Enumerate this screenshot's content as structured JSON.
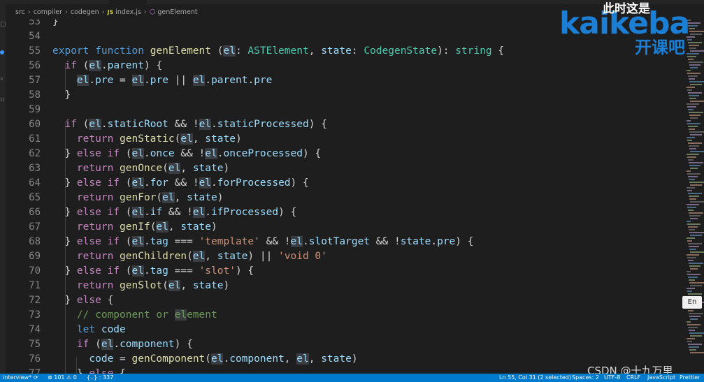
{
  "breadcrumb": [
    "src",
    "compiler",
    "codegen",
    "index.js",
    "genElement"
  ],
  "lines": [
    {
      "n": "53",
      "segs": [
        [
          "p",
          "}"
        ]
      ]
    },
    {
      "n": "54",
      "segs": []
    },
    {
      "n": "55",
      "segs": [
        [
          "kwb",
          "export "
        ],
        [
          "kwb",
          "function "
        ],
        [
          "fn",
          "genElement"
        ],
        [
          "p",
          " ("
        ],
        [
          "var hl",
          "el"
        ],
        [
          "p",
          ": "
        ],
        [
          "ty",
          "ASTElement"
        ],
        [
          "p",
          ", "
        ],
        [
          "var",
          "state"
        ],
        [
          "p",
          ": "
        ],
        [
          "ty",
          "CodegenState"
        ],
        [
          "p",
          "): "
        ],
        [
          "ty",
          "string"
        ],
        [
          "p",
          " {"
        ]
      ]
    },
    {
      "n": "56",
      "segs": [
        [
          "p",
          "  "
        ],
        [
          "kw",
          "if"
        ],
        [
          "p",
          " ("
        ],
        [
          "var hl",
          "el"
        ],
        [
          "p",
          "."
        ],
        [
          "var",
          "parent"
        ],
        [
          "p",
          ") {"
        ]
      ]
    },
    {
      "n": "57",
      "segs": [
        [
          "p",
          "    "
        ],
        [
          "var hl",
          "el"
        ],
        [
          "p",
          "."
        ],
        [
          "var",
          "pre"
        ],
        [
          "p",
          " = "
        ],
        [
          "var hl",
          "el"
        ],
        [
          "p",
          "."
        ],
        [
          "var",
          "pre"
        ],
        [
          "p",
          " || "
        ],
        [
          "var hl",
          "el"
        ],
        [
          "p",
          "."
        ],
        [
          "var",
          "parent"
        ],
        [
          "p",
          "."
        ],
        [
          "var",
          "pre"
        ]
      ]
    },
    {
      "n": "58",
      "segs": [
        [
          "p",
          "  }"
        ]
      ]
    },
    {
      "n": "59",
      "segs": []
    },
    {
      "n": "60",
      "segs": [
        [
          "p",
          "  "
        ],
        [
          "kw",
          "if"
        ],
        [
          "p",
          " ("
        ],
        [
          "var hl",
          "el"
        ],
        [
          "p",
          "."
        ],
        [
          "var",
          "staticRoot"
        ],
        [
          "p",
          " && !"
        ],
        [
          "var hl",
          "el"
        ],
        [
          "p",
          "."
        ],
        [
          "var",
          "staticProcessed"
        ],
        [
          "p",
          ") {"
        ]
      ]
    },
    {
      "n": "61",
      "segs": [
        [
          "p",
          "    "
        ],
        [
          "kw",
          "return "
        ],
        [
          "fn",
          "genStatic"
        ],
        [
          "p",
          "("
        ],
        [
          "var hl",
          "el"
        ],
        [
          "p",
          ", "
        ],
        [
          "var",
          "state"
        ],
        [
          "p",
          ")"
        ]
      ]
    },
    {
      "n": "62",
      "segs": [
        [
          "p",
          "  } "
        ],
        [
          "kw",
          "else if"
        ],
        [
          "p",
          " ("
        ],
        [
          "var hl",
          "el"
        ],
        [
          "p",
          "."
        ],
        [
          "var",
          "once"
        ],
        [
          "p",
          " && !"
        ],
        [
          "var hl",
          "el"
        ],
        [
          "p",
          "."
        ],
        [
          "var",
          "onceProcessed"
        ],
        [
          "p",
          ") {"
        ]
      ]
    },
    {
      "n": "63",
      "segs": [
        [
          "p",
          "    "
        ],
        [
          "kw",
          "return "
        ],
        [
          "fn",
          "genOnce"
        ],
        [
          "p",
          "("
        ],
        [
          "var hl",
          "el"
        ],
        [
          "p",
          ", "
        ],
        [
          "var",
          "state"
        ],
        [
          "p",
          ")"
        ]
      ]
    },
    {
      "n": "64",
      "segs": [
        [
          "p",
          "  } "
        ],
        [
          "kw",
          "else if"
        ],
        [
          "p",
          " ("
        ],
        [
          "var hl",
          "el"
        ],
        [
          "p",
          "."
        ],
        [
          "var",
          "for"
        ],
        [
          "p",
          " && !"
        ],
        [
          "var hl",
          "el"
        ],
        [
          "p",
          "."
        ],
        [
          "var",
          "forProcessed"
        ],
        [
          "p",
          ") {"
        ]
      ]
    },
    {
      "n": "65",
      "segs": [
        [
          "p",
          "    "
        ],
        [
          "kw",
          "return "
        ],
        [
          "fn",
          "genFor"
        ],
        [
          "p",
          "("
        ],
        [
          "var hl",
          "el"
        ],
        [
          "p",
          ", "
        ],
        [
          "var",
          "state"
        ],
        [
          "p",
          ")"
        ]
      ]
    },
    {
      "n": "66",
      "segs": [
        [
          "p",
          "  } "
        ],
        [
          "kw",
          "else if"
        ],
        [
          "p",
          " ("
        ],
        [
          "var hl",
          "el"
        ],
        [
          "p",
          "."
        ],
        [
          "var",
          "if"
        ],
        [
          "p",
          " && !"
        ],
        [
          "var hl",
          "el"
        ],
        [
          "p",
          "."
        ],
        [
          "var",
          "ifProcessed"
        ],
        [
          "p",
          ") {"
        ]
      ]
    },
    {
      "n": "67",
      "segs": [
        [
          "p",
          "    "
        ],
        [
          "kw",
          "return "
        ],
        [
          "fn",
          "genIf"
        ],
        [
          "p",
          "("
        ],
        [
          "var hl",
          "el"
        ],
        [
          "p",
          ", "
        ],
        [
          "var",
          "state"
        ],
        [
          "p",
          ")"
        ]
      ]
    },
    {
      "n": "68",
      "segs": [
        [
          "p",
          "  } "
        ],
        [
          "kw",
          "else if"
        ],
        [
          "p",
          " ("
        ],
        [
          "var hl",
          "el"
        ],
        [
          "p",
          "."
        ],
        [
          "var",
          "tag"
        ],
        [
          "p",
          " === "
        ],
        [
          "str",
          "'template'"
        ],
        [
          "p",
          " && !"
        ],
        [
          "var hl",
          "el"
        ],
        [
          "p",
          "."
        ],
        [
          "var",
          "slotTarget"
        ],
        [
          "p",
          " && !"
        ],
        [
          "var",
          "state"
        ],
        [
          "p",
          "."
        ],
        [
          "var",
          "pre"
        ],
        [
          "p",
          ") {"
        ]
      ]
    },
    {
      "n": "69",
      "segs": [
        [
          "p",
          "    "
        ],
        [
          "kw",
          "return "
        ],
        [
          "fn",
          "genChildren"
        ],
        [
          "p",
          "("
        ],
        [
          "var hl",
          "el"
        ],
        [
          "p",
          ", "
        ],
        [
          "var",
          "state"
        ],
        [
          "p",
          ") || "
        ],
        [
          "str",
          "'void 0'"
        ]
      ]
    },
    {
      "n": "70",
      "segs": [
        [
          "p",
          "  } "
        ],
        [
          "kw",
          "else if"
        ],
        [
          "p",
          " ("
        ],
        [
          "var hl",
          "el"
        ],
        [
          "p",
          "."
        ],
        [
          "var",
          "tag"
        ],
        [
          "p",
          " === "
        ],
        [
          "str",
          "'slot'"
        ],
        [
          "p",
          ") {"
        ]
      ]
    },
    {
      "n": "71",
      "segs": [
        [
          "p",
          "    "
        ],
        [
          "kw",
          "return "
        ],
        [
          "fn",
          "genSlot"
        ],
        [
          "p",
          "("
        ],
        [
          "var hl",
          "el"
        ],
        [
          "p",
          ", "
        ],
        [
          "var",
          "state"
        ],
        [
          "p",
          ")"
        ]
      ]
    },
    {
      "n": "72",
      "segs": [
        [
          "p",
          "  } "
        ],
        [
          "kw",
          "else"
        ],
        [
          "p",
          " {"
        ]
      ]
    },
    {
      "n": "73",
      "segs": [
        [
          "p",
          "    "
        ],
        [
          "cm",
          "// component or "
        ],
        [
          "cm hl",
          "el"
        ],
        [
          "cm",
          "ement"
        ]
      ]
    },
    {
      "n": "74",
      "segs": [
        [
          "p",
          "    "
        ],
        [
          "kwb",
          "let "
        ],
        [
          "var",
          "code"
        ]
      ]
    },
    {
      "n": "75",
      "segs": [
        [
          "p",
          "    "
        ],
        [
          "kw",
          "if"
        ],
        [
          "p",
          " ("
        ],
        [
          "var hl",
          "el"
        ],
        [
          "p",
          "."
        ],
        [
          "var",
          "component"
        ],
        [
          "p",
          ") {"
        ]
      ]
    },
    {
      "n": "76",
      "segs": [
        [
          "p",
          "      "
        ],
        [
          "var",
          "code"
        ],
        [
          "p",
          " = "
        ],
        [
          "fn",
          "genComponent"
        ],
        [
          "p",
          "("
        ],
        [
          "var hl",
          "el"
        ],
        [
          "p",
          "."
        ],
        [
          "var",
          "component"
        ],
        [
          "p",
          ", "
        ],
        [
          "var hl",
          "el"
        ],
        [
          "p",
          ", "
        ],
        [
          "var",
          "state"
        ],
        [
          "p",
          ")"
        ]
      ]
    },
    {
      "n": "77",
      "segs": [
        [
          "p",
          "    } "
        ],
        [
          "kw",
          "else"
        ],
        [
          "p",
          " {"
        ]
      ]
    }
  ],
  "logo": {
    "line1": "此时这是",
    "big": "kaikeba",
    "line2": "开课吧"
  },
  "en_badge": "En",
  "watermark": "CSDN @十九万里",
  "status": {
    "branch": "interview*",
    "problems": "⊗ 101 ⚠ 0",
    "selection_count": "{..} : 337",
    "position": "Ln 55, Col 31 (2 selected)",
    "spaces": "Spaces: 2",
    "encoding": "UTF-8",
    "eol": "CRLF",
    "language": "JavaScript",
    "formatter": "Prettier"
  },
  "colors": {
    "statusbar": "#007acc",
    "background": "#1e1e1e",
    "accent": "#1b7fd6"
  }
}
